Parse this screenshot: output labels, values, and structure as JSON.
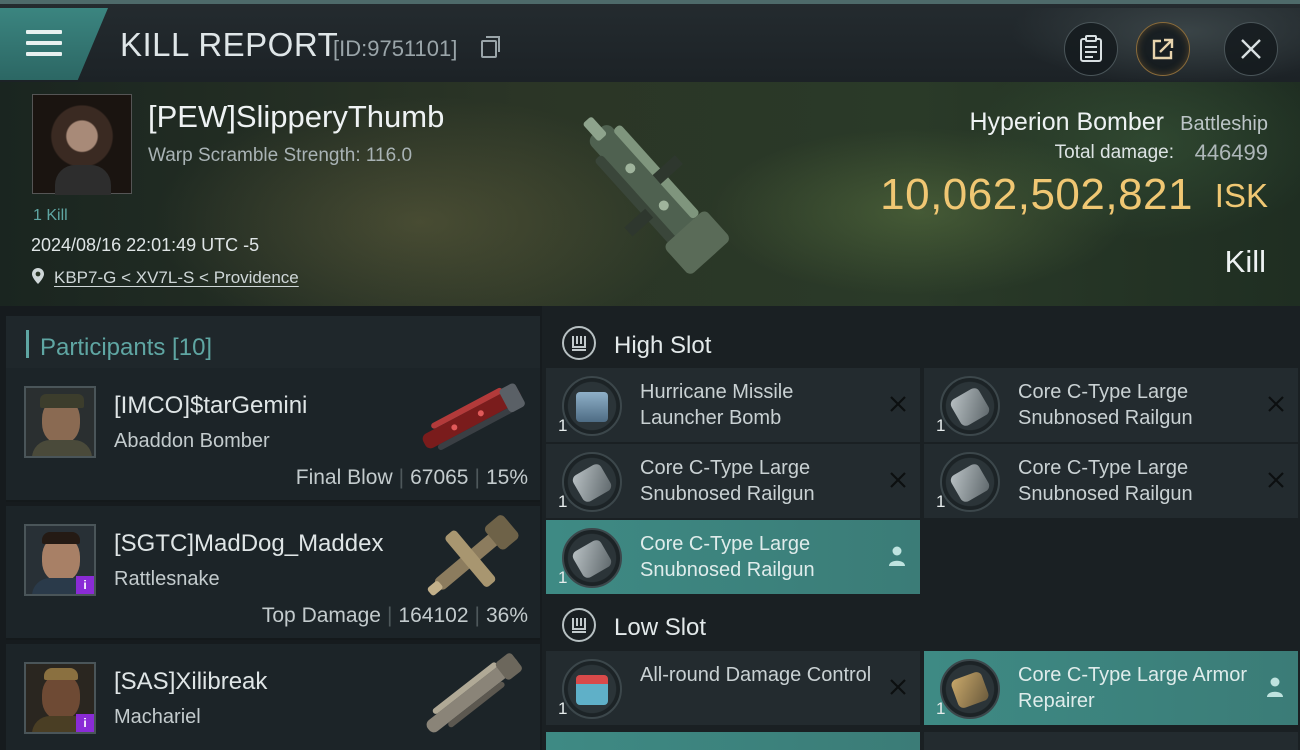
{
  "header": {
    "title": "KILL REPORT",
    "report_id": "[ID:9751101]"
  },
  "victim": {
    "pilot_name": "[PEW]SlipperyThumb",
    "warp_scramble": "Warp Scramble Strength: 116.0",
    "kills": "1 Kill",
    "datetime": "2024/08/16 22:01:49 UTC -5",
    "location": "KBP7-G < XV7L-S < Providence",
    "ship_name": "Hyperion Bomber",
    "ship_class": "Battleship",
    "total_damage_label": "Total damage:",
    "total_damage": "446499",
    "isk_value": "10,062,502,821",
    "isk_unit": "ISK",
    "result": "Kill"
  },
  "participants": {
    "title": "Participants [10]",
    "rows": [
      {
        "name": "[IMCO]$tarGemini",
        "ship": "Abaddon Bomber",
        "role": "Final Blow",
        "damage": "67065",
        "percent": "15%"
      },
      {
        "name": "[SGTC]MadDog_Maddex",
        "ship": "Rattlesnake",
        "role": "Top Damage",
        "damage": "164102",
        "percent": "36%"
      },
      {
        "name": "[SAS]Xilibreak",
        "ship": "Machariel",
        "role": "",
        "damage": "",
        "percent": ""
      }
    ]
  },
  "modules": {
    "high_slot_title": "High Slot",
    "low_slot_title": "Low Slot",
    "high": [
      {
        "name": "Hurricane Missile Launcher Bomb",
        "qty": "1",
        "state": "destroyed"
      },
      {
        "name": "Core C-Type Large Snubnosed Railgun",
        "qty": "1",
        "state": "destroyed"
      },
      {
        "name": "Core C-Type Large Snubnosed Railgun",
        "qty": "1",
        "state": "destroyed"
      },
      {
        "name": "Core C-Type Large Snubnosed Railgun",
        "qty": "1",
        "state": "destroyed"
      },
      {
        "name": "Core C-Type Large Snubnosed Railgun",
        "qty": "1",
        "state": "dropped"
      }
    ],
    "low": [
      {
        "name": "All-round Damage Control",
        "qty": "1",
        "state": "destroyed"
      },
      {
        "name": "Core C-Type Large Armor Repairer",
        "qty": "1",
        "state": "dropped"
      }
    ]
  },
  "colors": {
    "accent_teal": "#5fa6a3",
    "dropped_highlight": "#3e8a84",
    "isk_gold": "#f0c773",
    "badge_purple": "#8a2bd6"
  }
}
